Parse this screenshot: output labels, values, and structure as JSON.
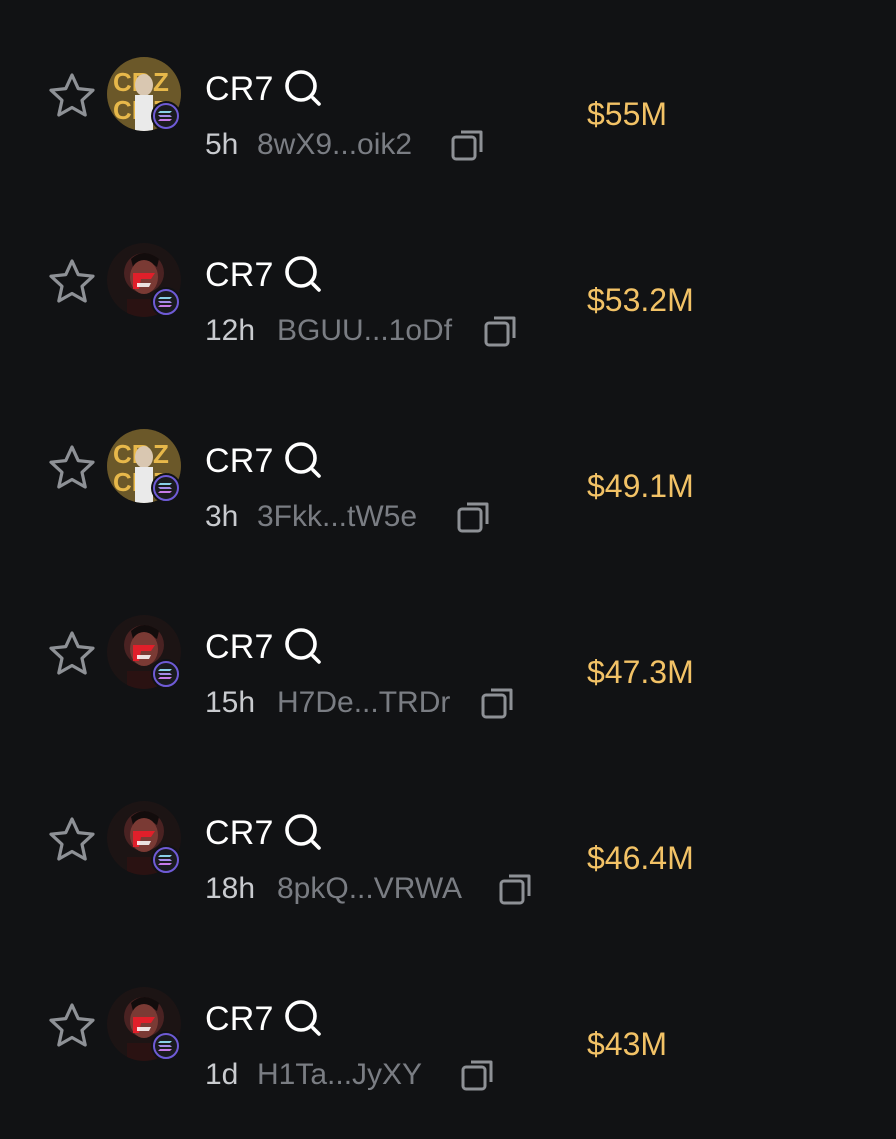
{
  "colors": {
    "background": "#111214",
    "name": "#ffffff",
    "age": "#c9cbcf",
    "address": "#7a7d83",
    "market_cap": "#f2c266"
  },
  "icons": {
    "star": "star-outline-icon",
    "search": "search-icon",
    "copy": "copy-icon",
    "chain": "solana-icon"
  },
  "tokens": [
    {
      "name": "CR7",
      "age": "5h",
      "address": "8wX9...oik2",
      "market_cap": "$55M",
      "avatar": "gold"
    },
    {
      "name": "CR7",
      "age": "12h",
      "address": "BGUU...1oDf",
      "market_cap": "$53.2M",
      "avatar": "red"
    },
    {
      "name": "CR7",
      "age": "3h",
      "address": "3Fkk...tW5e",
      "market_cap": "$49.1M",
      "avatar": "gold"
    },
    {
      "name": "CR7",
      "age": "15h",
      "address": "H7De...TRDr",
      "market_cap": "$47.3M",
      "avatar": "red"
    },
    {
      "name": "CR7",
      "age": "18h",
      "address": "8pkQ...VRWA",
      "market_cap": "$46.4M",
      "avatar": "red"
    },
    {
      "name": "CR7",
      "age": "1d",
      "address": "H1Ta...JyXY",
      "market_cap": "$43M",
      "avatar": "red"
    }
  ]
}
